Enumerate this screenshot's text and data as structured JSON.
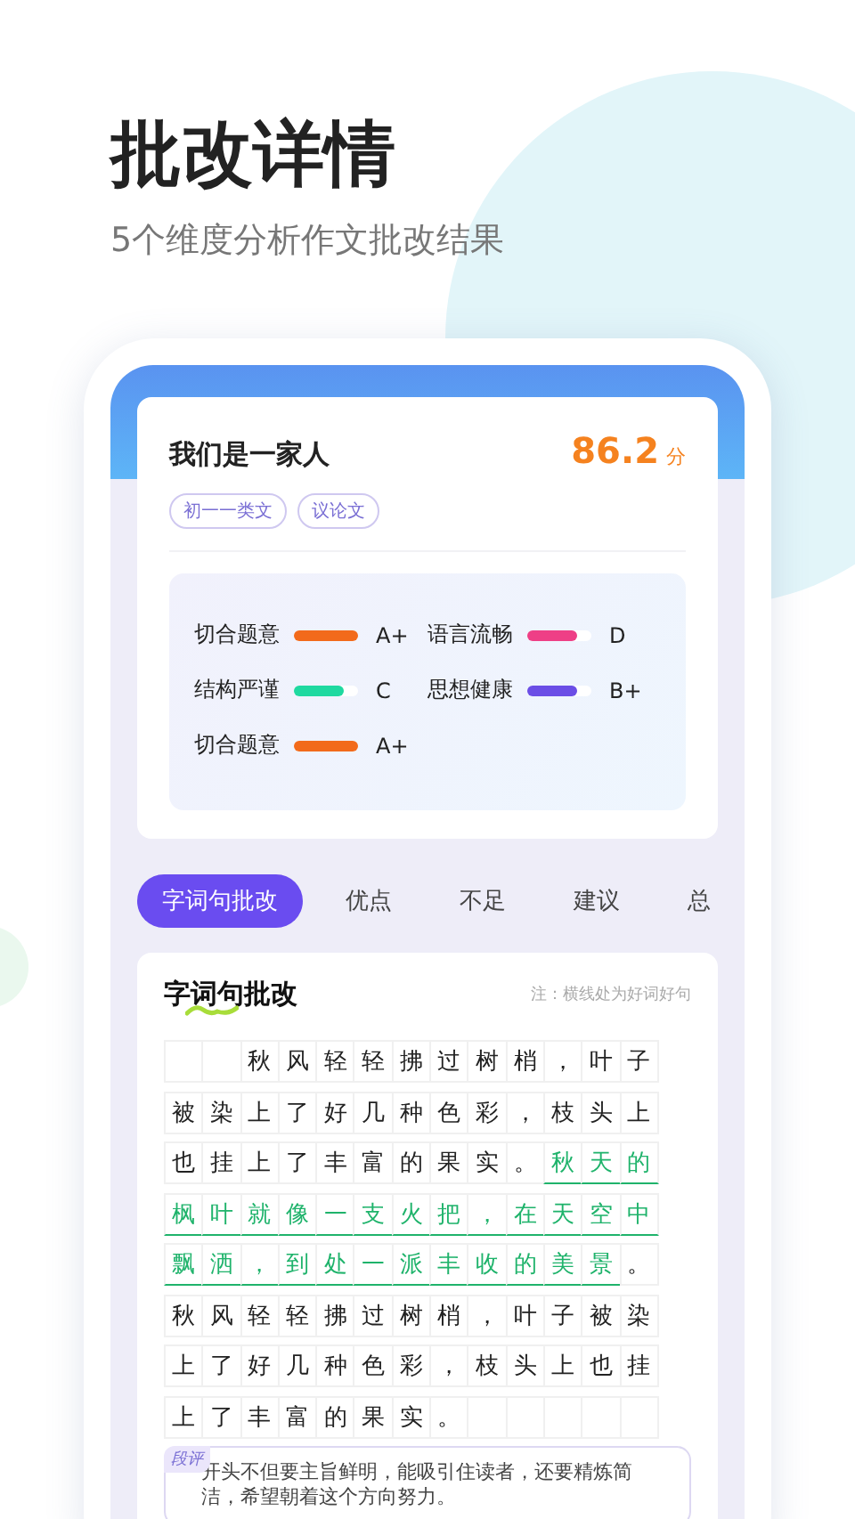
{
  "headline": "批改详情",
  "subheadline": "5个维度分析作文批改结果",
  "essay": {
    "title": "我们是一家人",
    "score": "86.2",
    "score_unit": "分",
    "tags": [
      "初一一类文",
      "议论文"
    ]
  },
  "metrics": [
    {
      "name": "切合题意",
      "grade": "A+",
      "level": 1.0,
      "color": "#f26a1b"
    },
    {
      "name": "语言流畅",
      "grade": "D",
      "level": 0.78,
      "color": "#ee3f86"
    },
    {
      "name": "结构严谨",
      "grade": "C",
      "level": 0.78,
      "color": "#1fd9a0"
    },
    {
      "name": "思想健康",
      "grade": "B+",
      "level": 0.78,
      "color": "#6b4ee6"
    },
    {
      "name": "切合题意",
      "grade": "A+",
      "level": 1.0,
      "color": "#f26a1b"
    }
  ],
  "tabs": [
    {
      "label": "字词句批改",
      "selected": true
    },
    {
      "label": "优点",
      "selected": false
    },
    {
      "label": "不足",
      "selected": false
    },
    {
      "label": "建议",
      "selected": false
    },
    {
      "label": "总",
      "selected": false
    }
  ],
  "section": {
    "title": "字词句批改",
    "note": "注：横线处为好词好句",
    "rows": [
      {
        "segments": [
          {
            "kind": "indent"
          },
          {
            "kind": "text",
            "text": "秋风轻轻拂过树梢，叶子",
            "highlighted": false
          }
        ]
      },
      {
        "segments": [
          {
            "kind": "text",
            "text": "被染上了好几种色彩，枝头上",
            "highlighted": false
          }
        ]
      },
      {
        "segments": [
          {
            "kind": "text",
            "text": "也挂上了丰富的果实。",
            "highlighted": false
          },
          {
            "kind": "text",
            "text": "秋天的",
            "highlighted": true
          }
        ]
      },
      {
        "segments": [
          {
            "kind": "text",
            "text": "枫叶就像一支火把，在天空中",
            "highlighted": true
          }
        ]
      },
      {
        "segments": [
          {
            "kind": "text",
            "text": "飘洒，到处一派丰收的美景",
            "highlighted": true
          },
          {
            "kind": "text",
            "text": "。",
            "highlighted": false
          }
        ]
      },
      {
        "segments": [
          {
            "kind": "text",
            "text": "秋风轻轻拂过树梢，叶子被染",
            "highlighted": false
          }
        ]
      },
      {
        "segments": [
          {
            "kind": "text",
            "text": "上了好几种色彩，枝头上也挂",
            "highlighted": false
          }
        ]
      },
      {
        "segments": [
          {
            "kind": "text",
            "text": "上了丰富的果实。",
            "highlighted": false
          }
        ]
      }
    ],
    "comment": {
      "label": "段评",
      "text": "开头不但要主旨鲜明，能吸引住读者，还要精炼简洁，希望朝着这个方向努力。"
    }
  }
}
